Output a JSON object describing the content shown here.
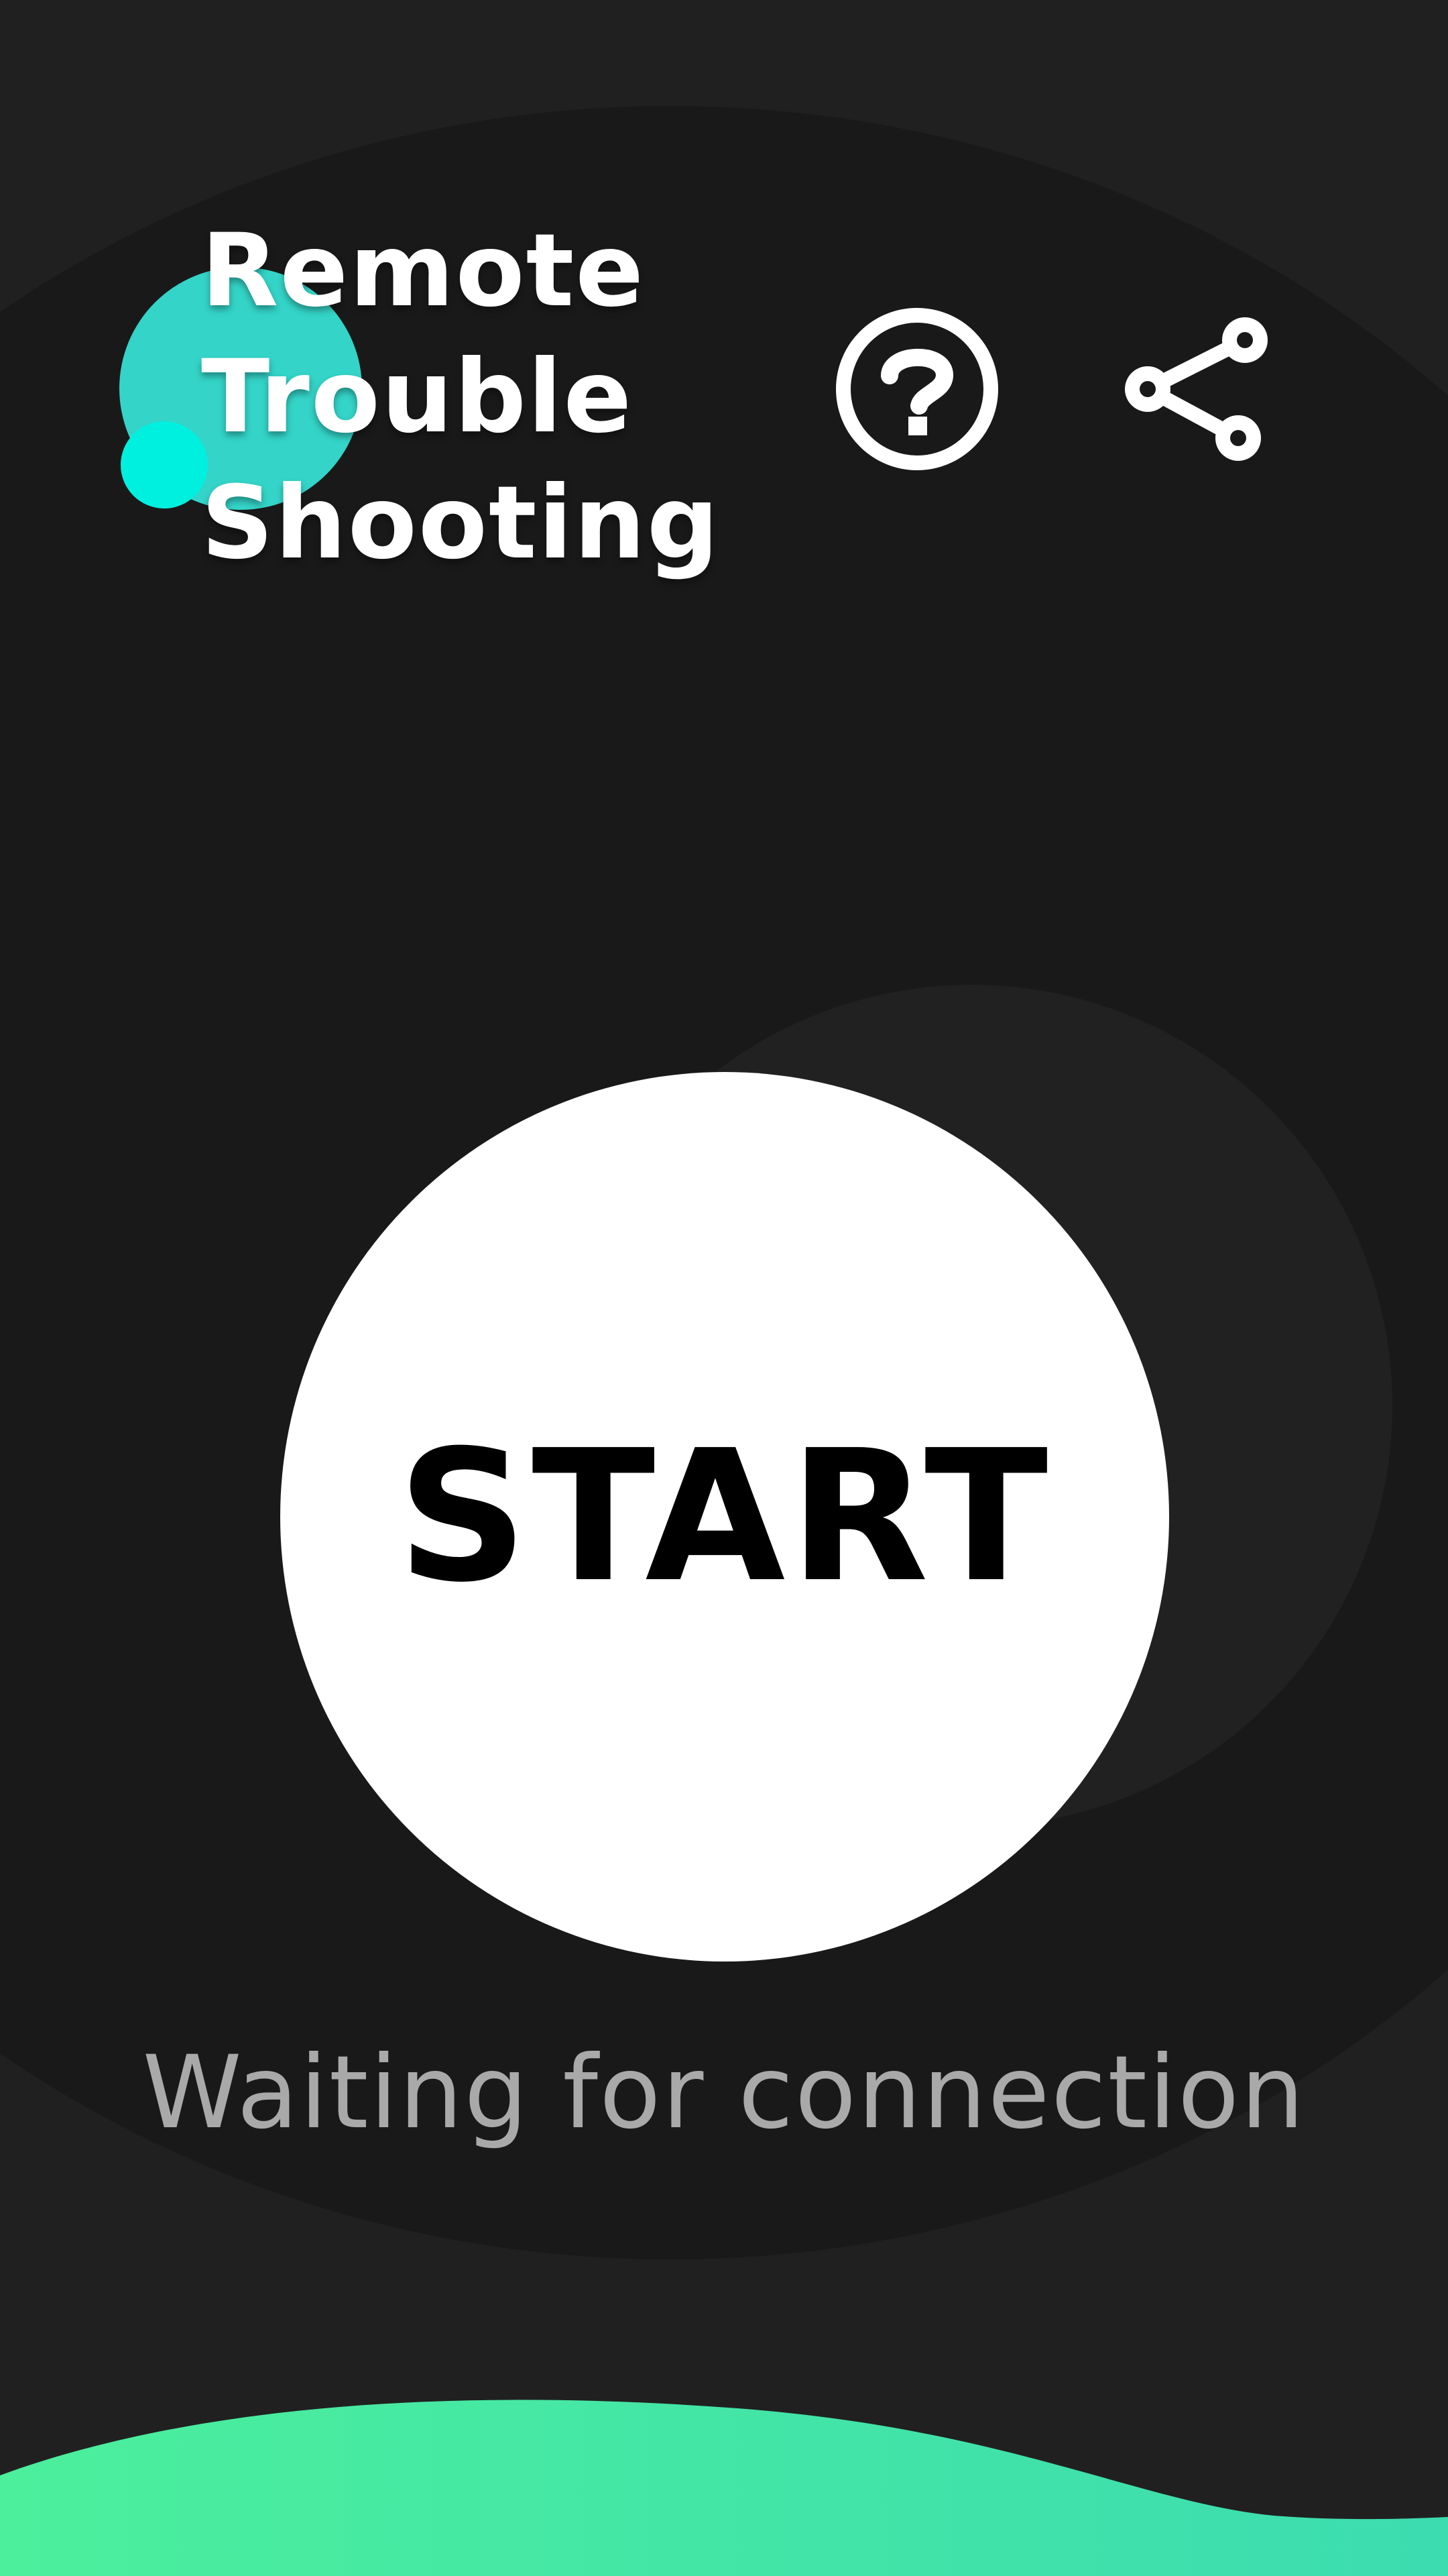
{
  "app": {
    "title_lines": [
      "Remote",
      "Trouble",
      "Shooting"
    ]
  },
  "header": {
    "help_icon": "question-circle-icon",
    "share_icon": "share-nodes-icon"
  },
  "main": {
    "start_label": "START",
    "status": "Waiting for connection"
  },
  "colors": {
    "background": "#202020",
    "background_shape": "#191919",
    "logo_teal": "#34d4c8",
    "logo_cyan": "#00f0e0",
    "wave_start": "#4bef9c",
    "wave_end": "#3cdcb0",
    "status_text": "#a9a9a9"
  }
}
